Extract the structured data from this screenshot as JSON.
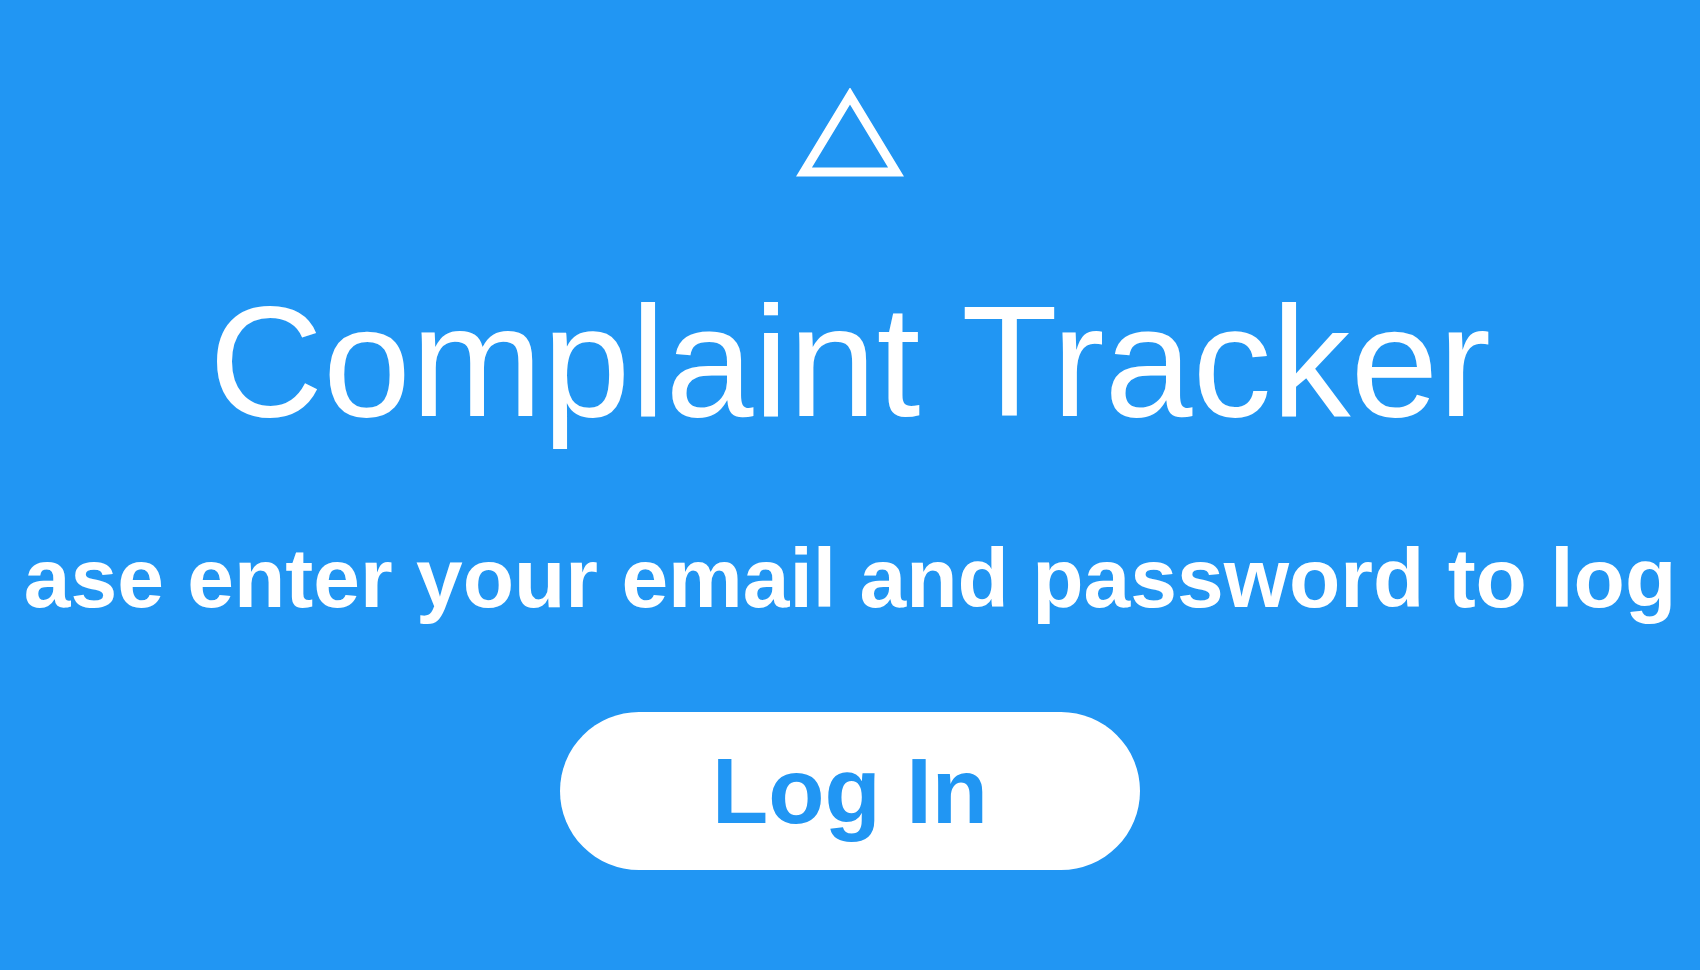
{
  "title": "Complaint Tracker",
  "subtitle": "ase enter your email and password to log",
  "login_button": "Log In"
}
